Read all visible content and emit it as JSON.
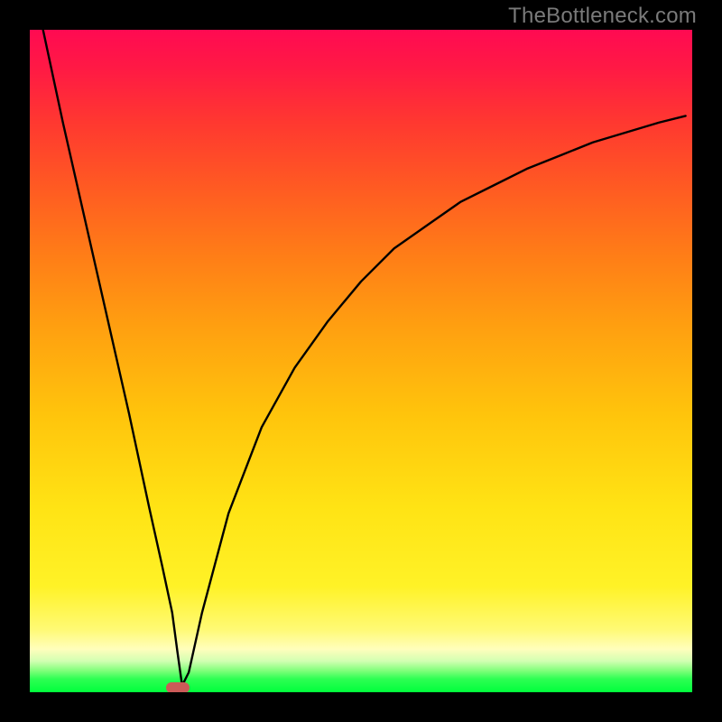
{
  "watermark": "TheBottleneck.com",
  "chart_data": {
    "type": "line",
    "title": "",
    "xlabel": "",
    "ylabel": "",
    "xlim": [
      0,
      100
    ],
    "ylim": [
      0,
      100
    ],
    "grid": false,
    "legend": false,
    "annotations": [],
    "series": [
      {
        "name": "curve",
        "x": [
          2,
          5,
          10,
          15,
          18,
          20,
          21.5,
          22.3,
          23,
          24,
          26,
          30,
          35,
          40,
          45,
          50,
          55,
          60,
          65,
          70,
          75,
          80,
          85,
          90,
          95,
          99
        ],
        "values": [
          100,
          86,
          64,
          42,
          28,
          19,
          12,
          6,
          1,
          3,
          12,
          27,
          40,
          49,
          56,
          62,
          67,
          70.5,
          74,
          76.5,
          79,
          81,
          83,
          84.5,
          86,
          87
        ]
      }
    ],
    "marker": {
      "x": 22.3,
      "y": 0,
      "color": "#cc5a58"
    }
  },
  "colors": {
    "frame": "#000000",
    "watermark": "#7a7a7a",
    "marker": "#cc5a58",
    "curve": "#000000"
  }
}
